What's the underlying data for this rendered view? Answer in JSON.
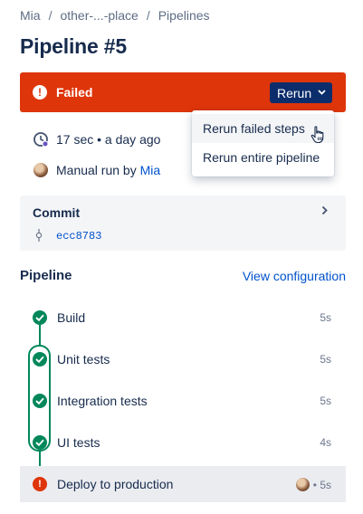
{
  "breadcrumb": {
    "items": [
      "Mia",
      "other-...-place",
      "Pipelines"
    ],
    "separator": "/"
  },
  "page_title": "Pipeline #5",
  "status": {
    "label": "Failed",
    "icon": "error-icon",
    "color": "#de350b"
  },
  "rerun_button": {
    "label": "Rerun",
    "color": "#0c2d6b"
  },
  "rerun_menu": {
    "items": [
      "Rerun failed steps",
      "Rerun entire pipeline"
    ]
  },
  "meta": {
    "duration_text": "17 sec • a day ago",
    "trigger_prefix": "Manual run by",
    "trigger_user": "Mia"
  },
  "commit": {
    "title": "Commit",
    "hash": "ecc8783"
  },
  "pipeline_section": {
    "title": "Pipeline",
    "view_config_label": "View configuration"
  },
  "steps": [
    {
      "label": "Build",
      "duration": "5s",
      "status": "success"
    },
    {
      "label": "Unit tests",
      "duration": "5s",
      "status": "success"
    },
    {
      "label": "Integration tests",
      "duration": "5s",
      "status": "success"
    },
    {
      "label": "UI tests",
      "duration": "4s",
      "status": "success"
    },
    {
      "label": "Deploy to production",
      "duration": "• 5s",
      "status": "failed"
    }
  ],
  "colors": {
    "success": "#00875a",
    "failure": "#de350b",
    "link": "#0052cc"
  }
}
